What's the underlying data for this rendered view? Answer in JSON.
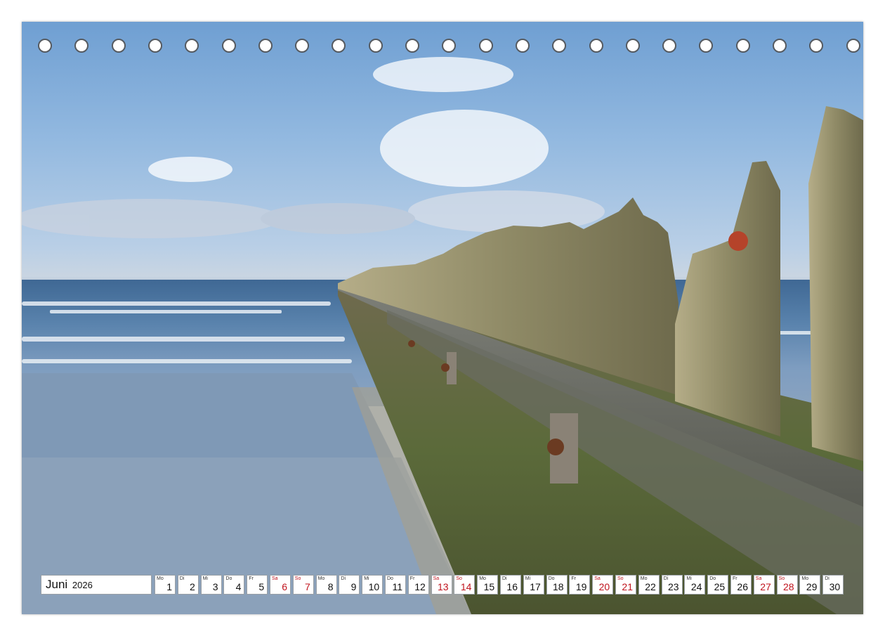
{
  "calendar": {
    "month": "Juni",
    "year": "2026",
    "days": [
      {
        "wd": "Mo",
        "n": "1",
        "we": false
      },
      {
        "wd": "Di",
        "n": "2",
        "we": false
      },
      {
        "wd": "Mi",
        "n": "3",
        "we": false
      },
      {
        "wd": "Do",
        "n": "4",
        "we": false
      },
      {
        "wd": "Fr",
        "n": "5",
        "we": false
      },
      {
        "wd": "Sa",
        "n": "6",
        "we": true
      },
      {
        "wd": "So",
        "n": "7",
        "we": true
      },
      {
        "wd": "Mo",
        "n": "8",
        "we": false
      },
      {
        "wd": "Di",
        "n": "9",
        "we": false
      },
      {
        "wd": "Mi",
        "n": "10",
        "we": false
      },
      {
        "wd": "Do",
        "n": "11",
        "we": false
      },
      {
        "wd": "Fr",
        "n": "12",
        "we": false
      },
      {
        "wd": "Sa",
        "n": "13",
        "we": true
      },
      {
        "wd": "So",
        "n": "14",
        "we": true
      },
      {
        "wd": "Mo",
        "n": "15",
        "we": false
      },
      {
        "wd": "Di",
        "n": "16",
        "we": false
      },
      {
        "wd": "Mi",
        "n": "17",
        "we": false
      },
      {
        "wd": "Do",
        "n": "18",
        "we": false
      },
      {
        "wd": "Fr",
        "n": "19",
        "we": false
      },
      {
        "wd": "Sa",
        "n": "20",
        "we": true
      },
      {
        "wd": "So",
        "n": "21",
        "we": true
      },
      {
        "wd": "Mo",
        "n": "22",
        "we": false
      },
      {
        "wd": "Di",
        "n": "23",
        "we": false
      },
      {
        "wd": "Mi",
        "n": "24",
        "we": false
      },
      {
        "wd": "Do",
        "n": "25",
        "we": false
      },
      {
        "wd": "Fr",
        "n": "26",
        "we": false
      },
      {
        "wd": "Sa",
        "n": "27",
        "we": true
      },
      {
        "wd": "So",
        "n": "28",
        "we": true
      },
      {
        "wd": "Mo",
        "n": "29",
        "we": false
      },
      {
        "wd": "Di",
        "n": "30",
        "we": false
      }
    ]
  },
  "colors": {
    "weekend": "#c0141e",
    "sky": "#93b9e0",
    "sea": "#5f86ad",
    "wood": "#8a8060"
  },
  "binding": {
    "hole_count": 23
  }
}
